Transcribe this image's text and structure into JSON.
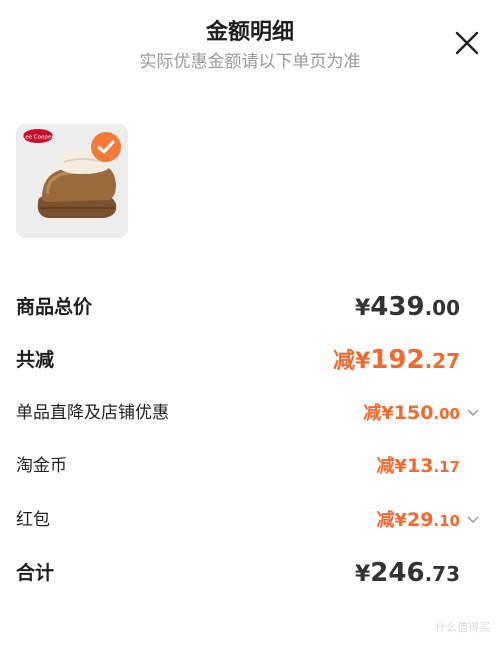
{
  "header": {
    "title": "金额明细",
    "subtitle": "实际优惠金额请以下单页为准",
    "close_icon": "close-icon"
  },
  "product": {
    "image_icon": "slipper-product-image",
    "selected_icon": "check-icon",
    "brand_logo_text": "Lee Cooper"
  },
  "rows": {
    "total": {
      "label": "商品总价",
      "currency": "¥",
      "integer": "439",
      "decimal": ".00"
    },
    "discount": {
      "label": "共减",
      "prefix": "减¥",
      "integer": "192",
      "decimal": ".27"
    },
    "shop": {
      "label": "单品直降及店铺优惠",
      "prefix": "减¥",
      "integer": "150",
      "decimal": ".00"
    },
    "coins": {
      "label": "淘金币",
      "prefix": "减¥",
      "integer": "13",
      "decimal": ".17"
    },
    "redpacket": {
      "label": "红包",
      "prefix": "减¥",
      "integer": "29",
      "decimal": ".10"
    },
    "sum": {
      "label": "合计",
      "currency": "¥",
      "integer": "246",
      "decimal": ".73"
    }
  },
  "watermark": "什么值得买",
  "colors": {
    "accent": "#f26a2e",
    "check_bg": "#f47a3a"
  }
}
